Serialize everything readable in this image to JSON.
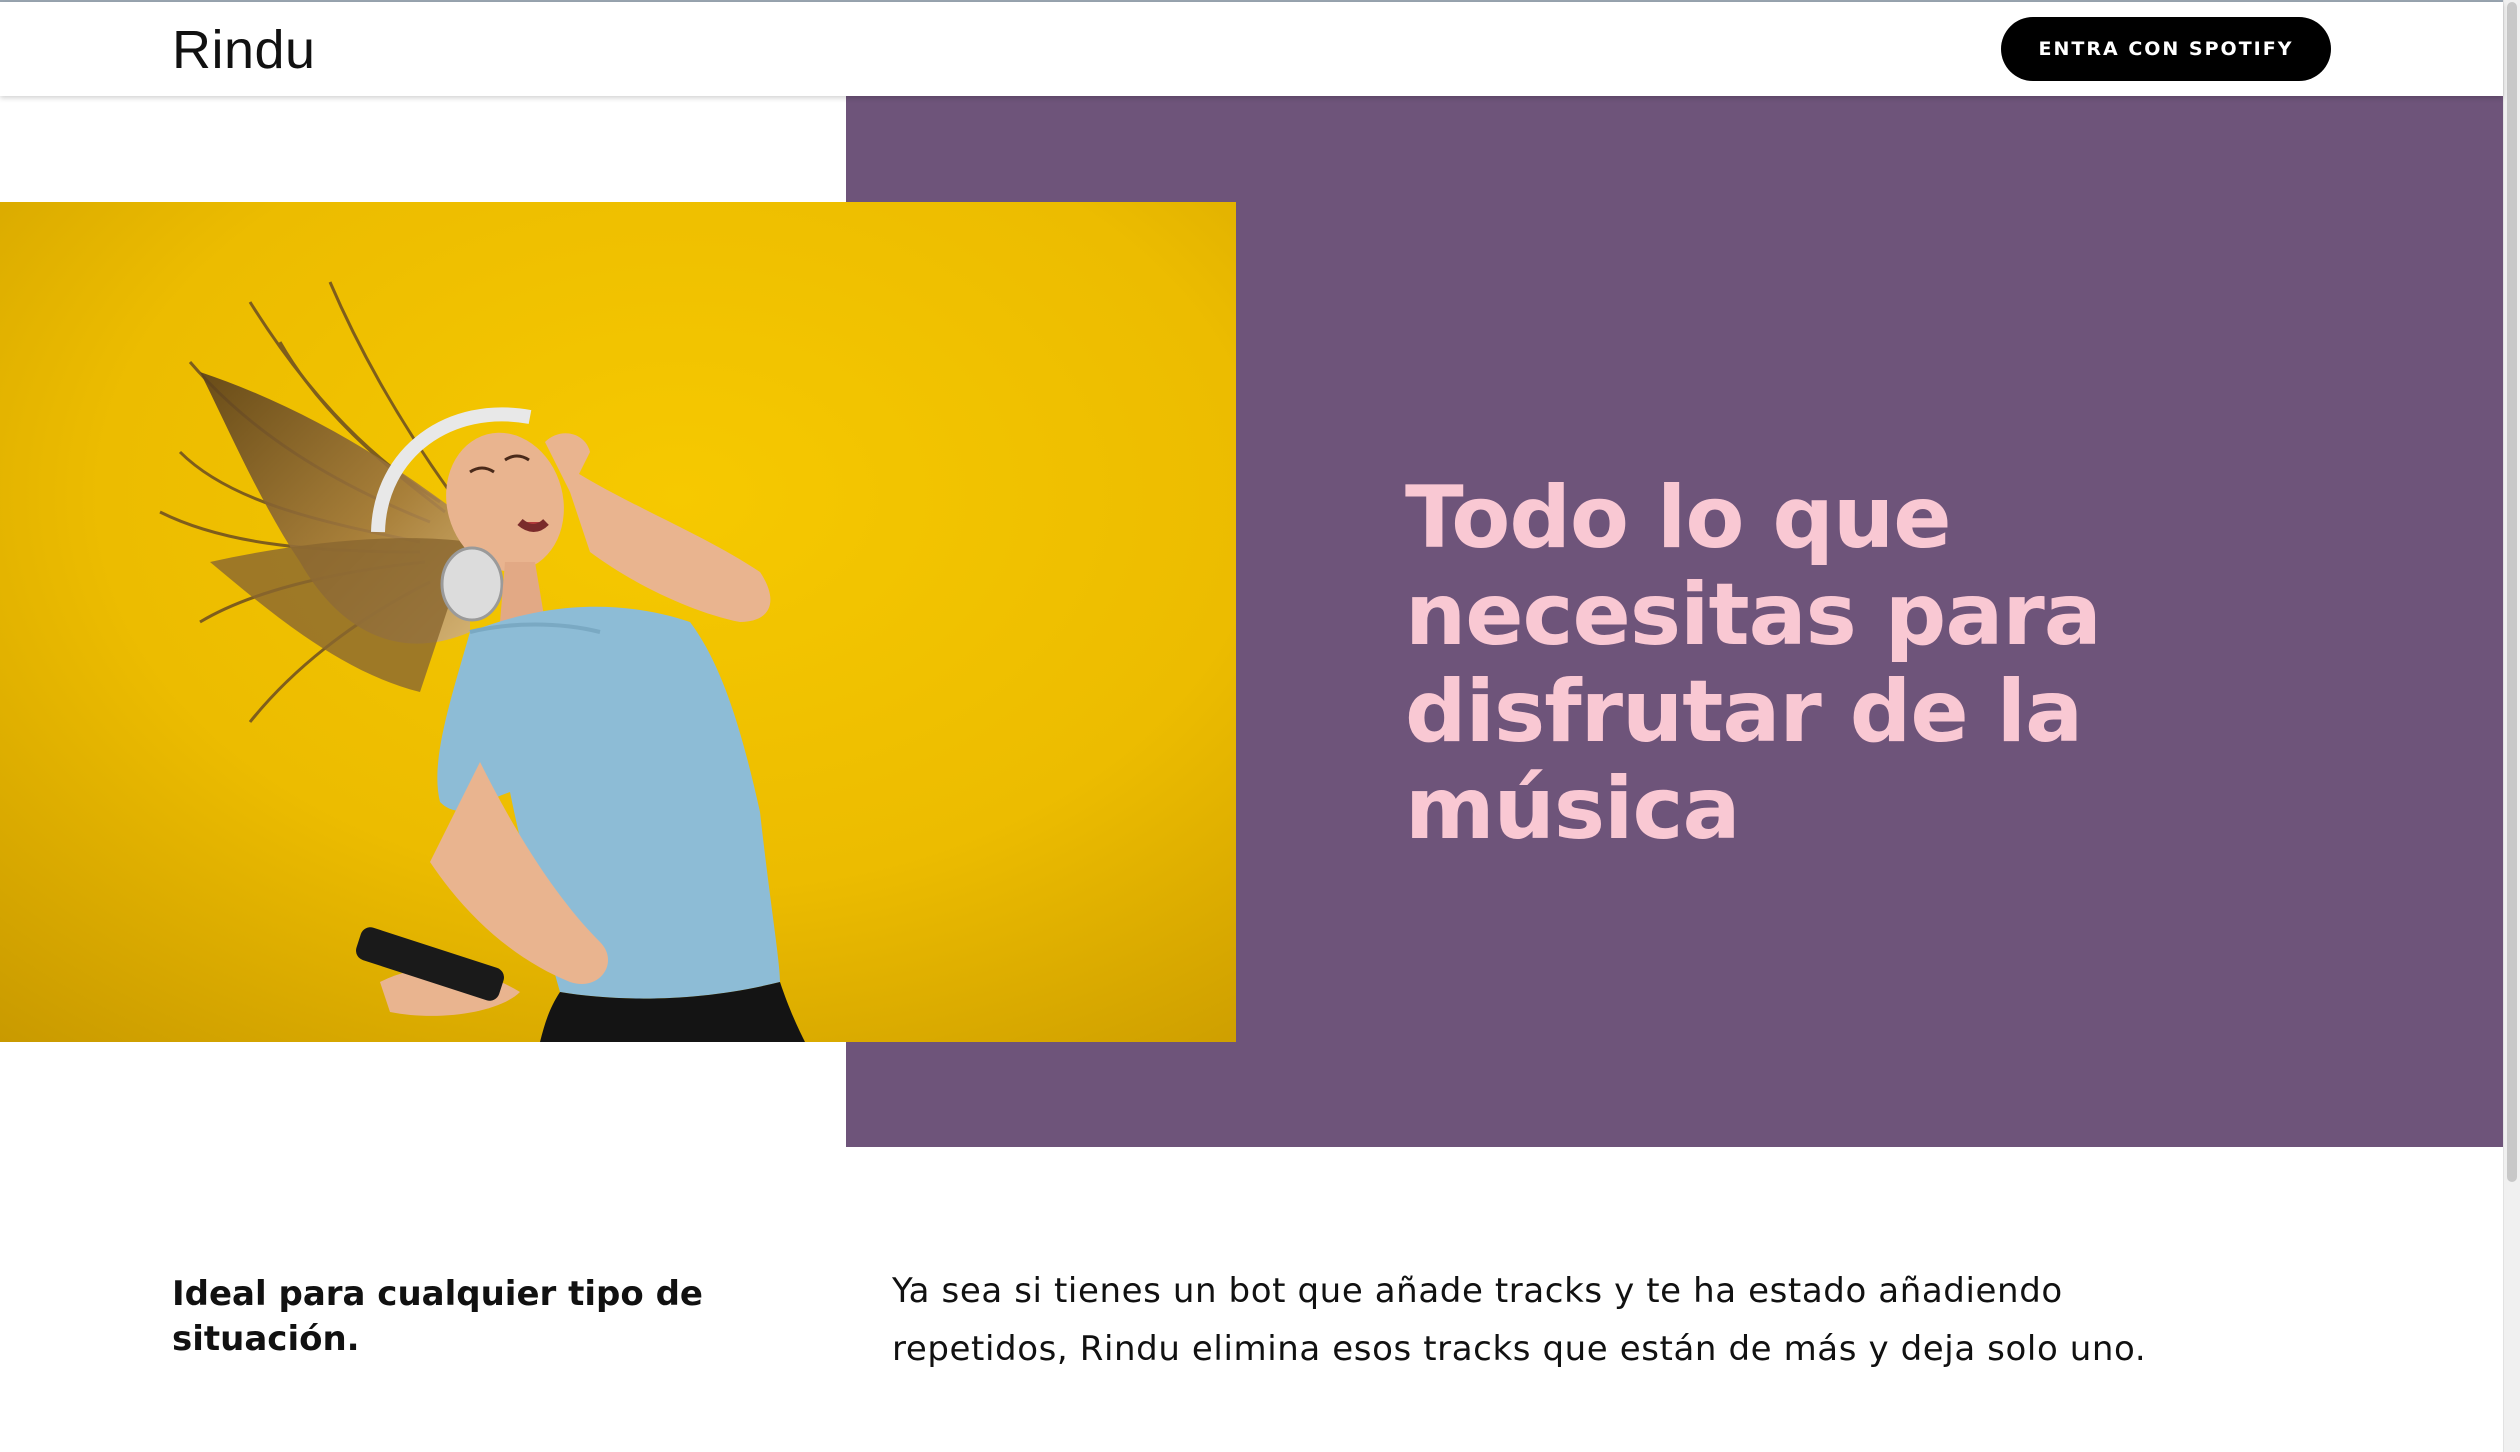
{
  "header": {
    "brand": "Rindu",
    "cta_label": "ENTRA CON SPOTIFY"
  },
  "hero": {
    "title": "Todo lo que necesitas para disfrutar de la música",
    "image_description_icon": "woman-dancing-with-headphones-photo"
  },
  "feature": {
    "heading": "Ideal para cualquier tipo de situación.",
    "text": "Ya sea si tienes un bot que añade tracks y te ha estado añadiendo repetidos, Rindu elimina esos tracks que están de más y deja solo uno."
  },
  "colors": {
    "purple_panel": "#6e547a",
    "title_pink": "#f9c8d3",
    "photo_yellow": "#f2c200",
    "button_black": "#000000"
  }
}
